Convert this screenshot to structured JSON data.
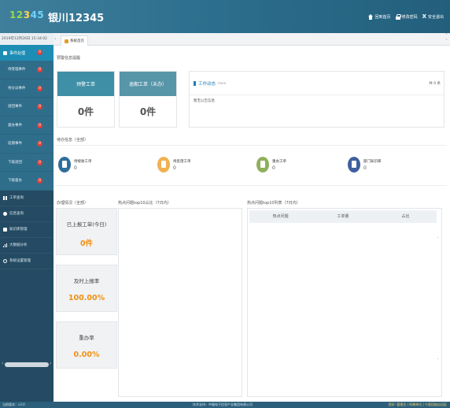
{
  "header": {
    "logo": [
      "12",
      "3",
      "45"
    ],
    "title": "银川12345",
    "actions": [
      "回到首页",
      "修改密码",
      "安全退出"
    ]
  },
  "sidebar": {
    "datetime": "2019年12月26日 15:34:02",
    "group_label": "事件处理",
    "group_badge": "0",
    "sub_items": [
      {
        "label": "待受理事件",
        "badge": "0"
      },
      {
        "label": "待分派事件",
        "badge": "0"
      },
      {
        "label": "退回事件",
        "badge": "0"
      },
      {
        "label": "督办事件",
        "badge": "0"
      },
      {
        "label": "延期事件",
        "badge": "0"
      },
      {
        "label": "下级退回",
        "badge": "0"
      },
      {
        "label": "下级督办",
        "badge": "0"
      }
    ],
    "items": [
      {
        "label": "工单查询",
        "icon": "grid-icon"
      },
      {
        "label": "信息查询",
        "icon": "info-icon"
      },
      {
        "label": "知识库管理",
        "icon": "book-icon"
      },
      {
        "label": "大数据分析",
        "icon": "bar-chart-icon"
      },
      {
        "label": "系统设置管理",
        "icon": "gear-icon"
      }
    ]
  },
  "tabs": {
    "active": "系统首页"
  },
  "main": {
    "section_pending": "预警信息提醒",
    "card1": {
      "label": "预警工单",
      "value": "0件",
      "color": "#3f8fa6"
    },
    "card2": {
      "label": "逾期工单（未办）",
      "value": "0件",
      "color": "#5795a8"
    },
    "notice": {
      "title": "工作动态",
      "more": "more",
      "count": "共 0 条",
      "empty": "暂无公告信息"
    },
    "section_todo": "待办信息（全部）",
    "todos": [
      {
        "label": "待接收工单",
        "value": "0",
        "color": "#2f6e9c"
      },
      {
        "label": "待反馈工单",
        "value": "0",
        "color": "#f0b150"
      },
      {
        "label": "重办工单",
        "value": "0",
        "color": "#8fb05a"
      },
      {
        "label": "部门知识库",
        "value": "0",
        "color": "#3f5f9e"
      }
    ],
    "section_stats": "办理情况（全部）",
    "stats": [
      {
        "label": "已上报工单(今日)",
        "value": "0件"
      },
      {
        "label": "及时上报率",
        "value": "100.00%"
      },
      {
        "label": "重办率",
        "value": "0.00%"
      }
    ],
    "section_hot10": "热点问题top10占比（7日内）",
    "section_hot10_list": "热点问题top10列表（7日内）",
    "hot_table_headers": [
      "热点问题",
      "工单量",
      "占比"
    ]
  },
  "footer": {
    "left": "当前版本：v3.0",
    "mid": "技术支持：中服电子信息产业集团有限公司",
    "right": "您好: 管理员 | 所属单位 | 宁夏回族自治区"
  }
}
